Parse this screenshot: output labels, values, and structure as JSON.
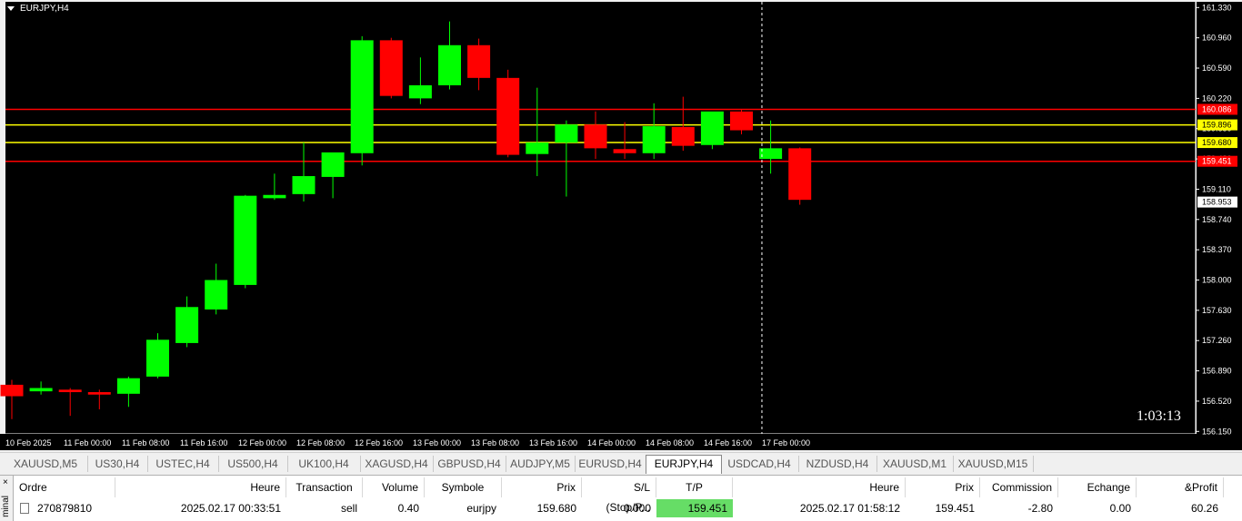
{
  "chart": {
    "title": "EURJPY,H4",
    "countdown": "1:03:13",
    "background": "#000000",
    "bull_color": "#00ff00",
    "bear_color": "#ff0000",
    "y_ticks": [
      "161.330",
      "160.960",
      "160.590",
      "160.220",
      "159.850",
      "159.480",
      "159.110",
      "158.740",
      "158.370",
      "158.000",
      "157.630",
      "157.260",
      "156.890",
      "156.520",
      "156.150"
    ],
    "x_ticks": [
      "10 Feb 2025",
      "11 Feb 00:00",
      "11 Feb 08:00",
      "11 Feb 16:00",
      "12 Feb 00:00",
      "12 Feb 08:00",
      "12 Feb 16:00",
      "13 Feb 00:00",
      "13 Feb 08:00",
      "13 Feb 16:00",
      "14 Feb 00:00",
      "14 Feb 08:00",
      "14 Feb 16:00",
      "17 Feb 00:00"
    ],
    "ylim": [
      156.12,
      161.4
    ],
    "hlines": [
      {
        "label": "160.086",
        "price": 160.086,
        "color": "#ff0000"
      },
      {
        "label": "159.896",
        "price": 159.896,
        "color": "#ffff00"
      },
      {
        "label": "159.680",
        "price": 159.68,
        "color": "#ffff00"
      },
      {
        "label": "159.451",
        "price": 159.451,
        "color": "#ff0000"
      }
    ],
    "current_price": "158.953",
    "candles": [
      {
        "o": 156.72,
        "h": 156.78,
        "l": 156.3,
        "c": 156.58
      },
      {
        "o": 156.64,
        "h": 156.76,
        "l": 156.6,
        "c": 156.68
      },
      {
        "o": 156.66,
        "h": 156.68,
        "l": 156.34,
        "c": 156.63
      },
      {
        "o": 156.63,
        "h": 156.66,
        "l": 156.42,
        "c": 156.6
      },
      {
        "o": 156.61,
        "h": 156.82,
        "l": 156.45,
        "c": 156.8
      },
      {
        "o": 156.82,
        "h": 157.35,
        "l": 156.8,
        "c": 157.27
      },
      {
        "o": 157.23,
        "h": 157.8,
        "l": 157.18,
        "c": 157.67
      },
      {
        "o": 157.64,
        "h": 158.2,
        "l": 157.58,
        "c": 158.0
      },
      {
        "o": 157.94,
        "h": 159.04,
        "l": 157.9,
        "c": 159.03
      },
      {
        "o": 159.0,
        "h": 159.3,
        "l": 158.98,
        "c": 159.04
      },
      {
        "o": 159.05,
        "h": 159.68,
        "l": 158.96,
        "c": 159.27
      },
      {
        "o": 159.26,
        "h": 159.52,
        "l": 159.0,
        "c": 159.56
      },
      {
        "o": 159.55,
        "h": 160.98,
        "l": 159.4,
        "c": 160.93
      },
      {
        "o": 160.93,
        "h": 160.96,
        "l": 160.22,
        "c": 160.25
      },
      {
        "o": 160.22,
        "h": 160.72,
        "l": 160.15,
        "c": 160.38
      },
      {
        "o": 160.38,
        "h": 161.16,
        "l": 160.33,
        "c": 160.87
      },
      {
        "o": 160.87,
        "h": 160.95,
        "l": 160.32,
        "c": 160.47
      },
      {
        "o": 160.47,
        "h": 160.57,
        "l": 159.5,
        "c": 159.53
      },
      {
        "o": 159.54,
        "h": 160.35,
        "l": 159.27,
        "c": 159.68
      },
      {
        "o": 159.68,
        "h": 159.95,
        "l": 159.02,
        "c": 159.9
      },
      {
        "o": 159.9,
        "h": 160.06,
        "l": 159.48,
        "c": 159.61
      },
      {
        "o": 159.6,
        "h": 159.93,
        "l": 159.48,
        "c": 159.55
      },
      {
        "o": 159.55,
        "h": 160.16,
        "l": 159.48,
        "c": 159.88
      },
      {
        "o": 159.87,
        "h": 160.24,
        "l": 159.58,
        "c": 159.64
      },
      {
        "o": 159.65,
        "h": 160.02,
        "l": 159.6,
        "c": 160.06
      },
      {
        "o": 160.06,
        "h": 160.08,
        "l": 159.78,
        "c": 159.83
      },
      {
        "o": 159.48,
        "h": 159.95,
        "l": 159.3,
        "c": 159.61
      },
      {
        "o": 159.61,
        "h": 159.62,
        "l": 158.92,
        "c": 158.98
      }
    ]
  },
  "tabs": [
    "XAUUSD,M5",
    "US30,H4",
    "USTEC,H4",
    "US500,H4",
    "UK100,H4",
    "XAGUSD,H4",
    "GBPUSD,H4",
    "AUDJPY,M5",
    "EURUSD,H4",
    "EURJPY,H4",
    "USDCAD,H4",
    "NZDUSD,H4",
    "XAUUSD,M1",
    "XAUUSD,M15"
  ],
  "active_tab": "EURJPY,H4",
  "terminal": {
    "side_label": "minal",
    "close_glyph": "×",
    "headers": [
      "Ordre",
      "Heure",
      "Transaction",
      "Volume",
      "Symbole",
      "Prix",
      "S/L (Stop/P...",
      "T/P (Prendr...",
      "Heure",
      "Prix",
      "Commission",
      "Echange",
      "&Profit"
    ],
    "row": {
      "order": "270879810",
      "time_open": "2025.02.17 00:33:51",
      "type": "sell",
      "volume": "0.40",
      "symbol": "eurjpy",
      "price_open": "159.680",
      "sl": "0.000",
      "tp": "159.451",
      "time_close": "2025.02.17 01:58:12",
      "price_close": "159.451",
      "commission": "-2.80",
      "swap": "0.00",
      "profit": "60.26"
    },
    "tp_highlight": "#66dd66"
  }
}
